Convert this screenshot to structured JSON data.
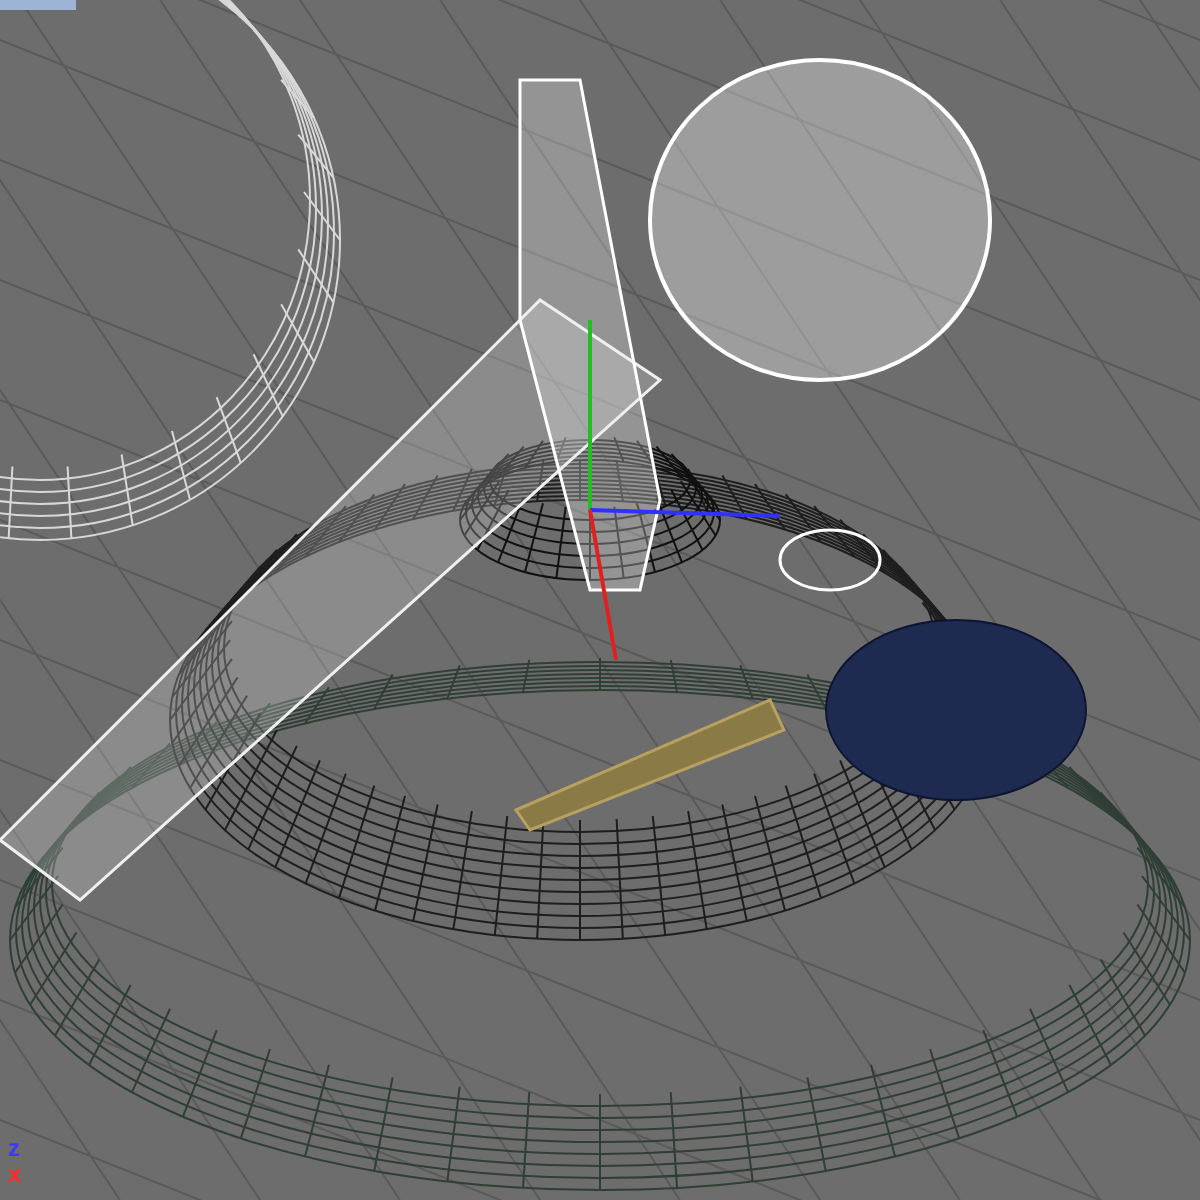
{
  "viewport": {
    "axis_labels": [
      "z",
      "x"
    ]
  }
}
